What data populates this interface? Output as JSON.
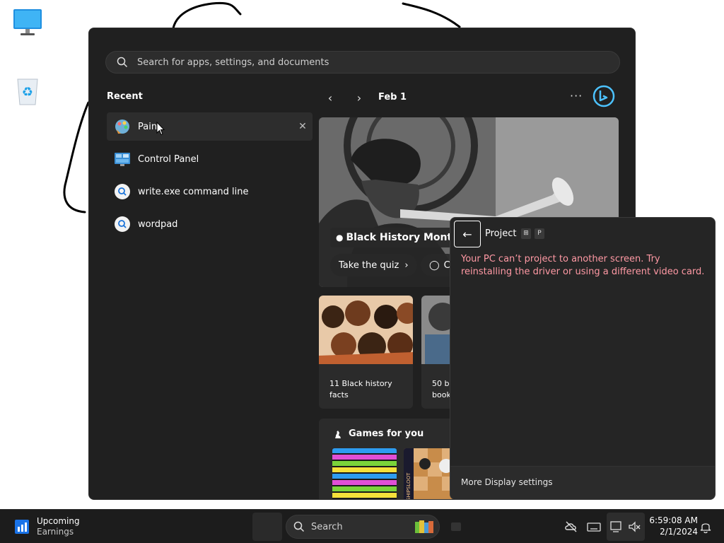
{
  "desktop": {
    "icons": [
      {
        "name": "this-pc-icon"
      },
      {
        "name": "recycle-bin-icon"
      }
    ]
  },
  "start_menu": {
    "search_placeholder": "Search for apps, settings, and documents",
    "recent_title": "Recent",
    "recent_items": [
      {
        "label": "Pain",
        "icon": "paint-icon",
        "active": true
      },
      {
        "label": "Control Panel",
        "icon": "control-panel-icon",
        "active": false
      },
      {
        "label": "write.exe command line",
        "icon": "search-icon",
        "active": false
      },
      {
        "label": "wordpad",
        "icon": "search-icon",
        "active": false
      }
    ],
    "feed": {
      "date": "Feb 1",
      "hero_title": "Black History Month",
      "hero_button": "Take the quiz",
      "hero_button2": "C",
      "cards": [
        {
          "title_line1": "11 Black history",
          "title_line2": "facts"
        },
        {
          "title_line1": "50 bi",
          "title_line2": "book"
        }
      ],
      "games_title": "Games for you",
      "game_tile_text": "SHIPSLOOT"
    }
  },
  "project_flyout": {
    "title": "Project",
    "key1": "⊞",
    "key2": "P",
    "message": "Your PC can’t project to another screen. Try reinstalling the driver or using a different video card.",
    "footer_link": "More Display settings"
  },
  "taskbar": {
    "widget_title": "Upcoming",
    "widget_subtitle": "Earnings",
    "search_label": "Search",
    "time": "6:59:08 AM",
    "date": "2/1/2024"
  },
  "colors": {
    "panel_bg": "#202020",
    "error_text": "#ff99a4",
    "accent": "#4cc2ff"
  }
}
